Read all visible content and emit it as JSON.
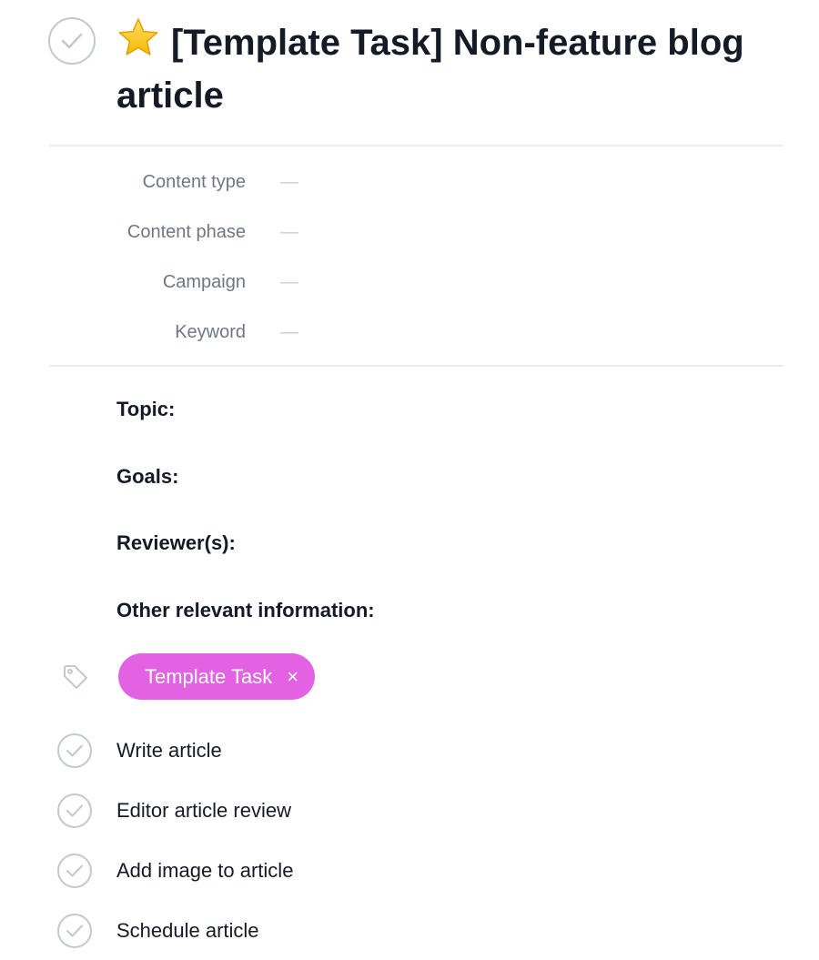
{
  "task": {
    "title": "[Template Task] Non-feature blog article",
    "title_icon": "star-icon",
    "completed": false
  },
  "fields": [
    {
      "label": "Content type",
      "value": "—"
    },
    {
      "label": "Content phase",
      "value": "—"
    },
    {
      "label": "Campaign",
      "value": "—"
    },
    {
      "label": "Keyword",
      "value": "—"
    }
  ],
  "description": {
    "lines": [
      "Topic:",
      "Goals:",
      "Reviewer(s):",
      "Other relevant information:"
    ]
  },
  "tags": {
    "icon": "tag-icon",
    "items": [
      {
        "label": "Template Task",
        "remove_label": "×",
        "color": "#e362e3"
      }
    ]
  },
  "subtasks": [
    {
      "label": "Write article",
      "completed": false
    },
    {
      "label": "Editor article review",
      "completed": false
    },
    {
      "label": "Add image to article",
      "completed": false
    },
    {
      "label": "Schedule article",
      "completed": false
    }
  ],
  "colors": {
    "text_primary": "#151b26",
    "text_secondary": "#6f7782",
    "checkmark": "#c4c8cc",
    "divider": "#e8ecee"
  }
}
